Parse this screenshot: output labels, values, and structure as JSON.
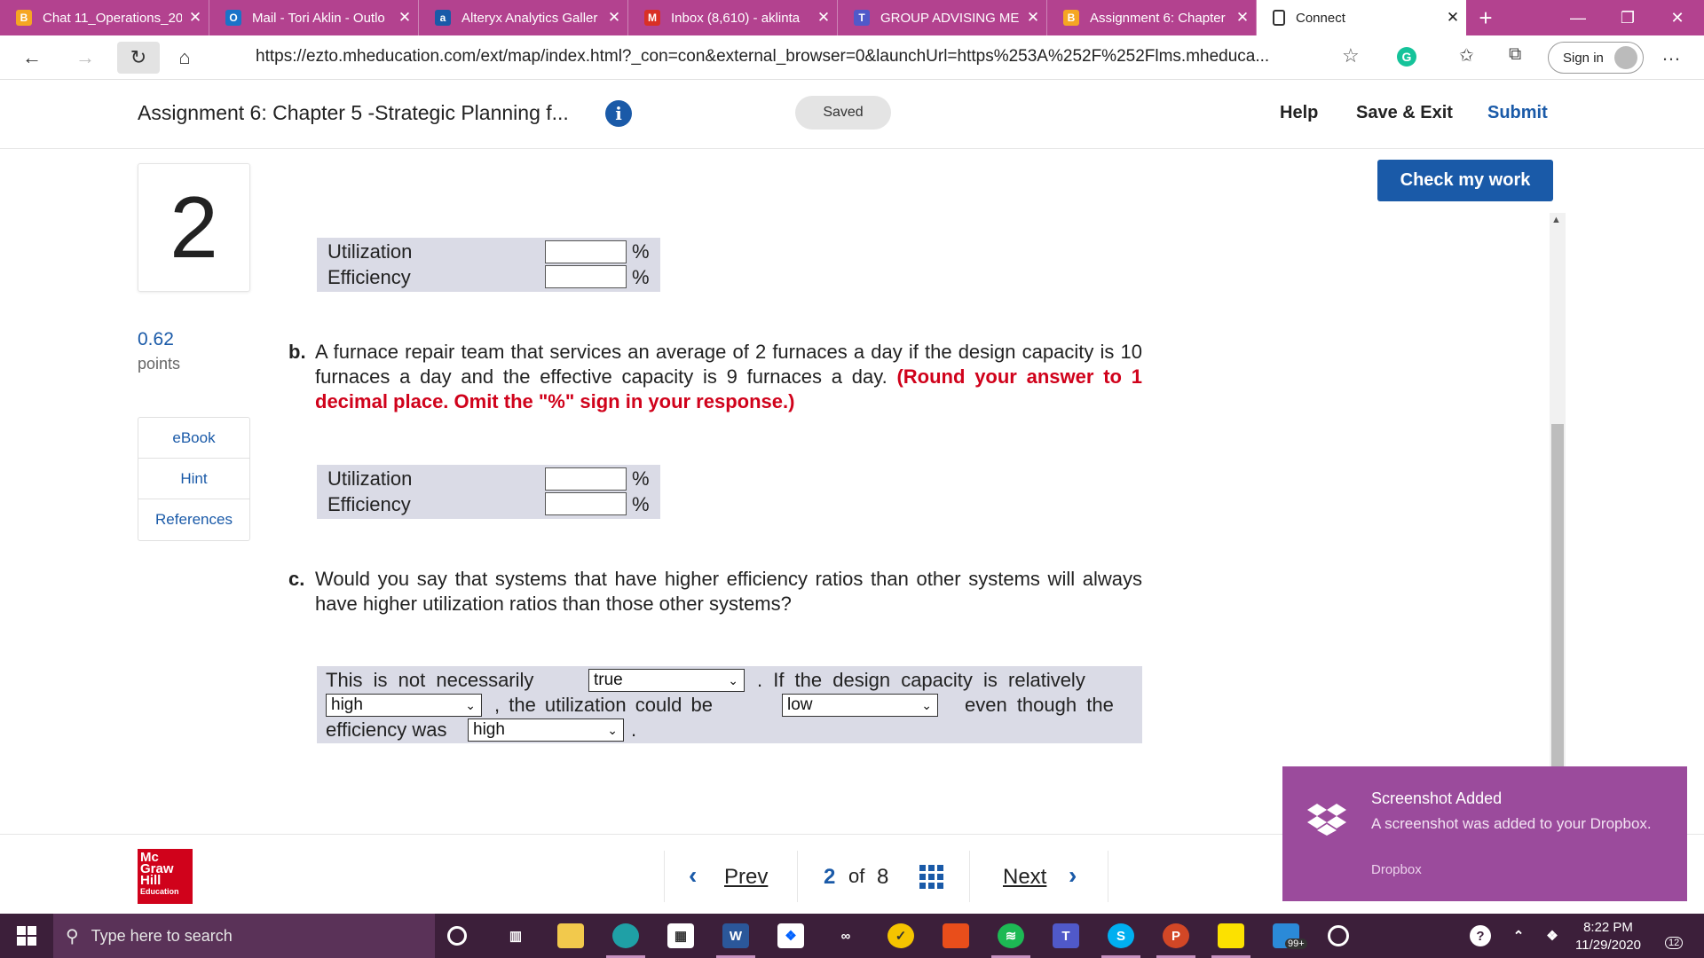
{
  "browser": {
    "tabs": [
      {
        "label": "Chat 11_Operations_20",
        "fav": "B",
        "color": "#f5a623"
      },
      {
        "label": "Mail - Tori Aklin - Outlo",
        "fav": "O",
        "color": "#1a73c8"
      },
      {
        "label": "Alteryx Analytics Galler",
        "fav": "a",
        "color": "#1a5aa8"
      },
      {
        "label": "Inbox (8,610) - aklinta",
        "fav": "M",
        "color": "#d93025"
      },
      {
        "label": "GROUP ADVISING MEE",
        "fav": "T",
        "color": "#5059c9"
      },
      {
        "label": "Assignment 6: Chapter",
        "fav": "B",
        "color": "#f5a623"
      },
      {
        "label": "Connect",
        "fav": "",
        "color": "#ffffff"
      }
    ],
    "url": "https://ezto.mheducation.com/ext/map/index.html?_con=con&external_browser=0&launchUrl=https%253A%252F%252Flms.mheduca...",
    "signin_label": "Sign in"
  },
  "header": {
    "title": "Assignment 6: Chapter 5 -Strategic Planning f...",
    "info_icon": "i",
    "saved_label": "Saved",
    "help_label": "Help",
    "save_exit_label": "Save & Exit",
    "submit_label": "Submit"
  },
  "question": {
    "number": "2",
    "points": "0.62",
    "points_label": "points",
    "side_buttons": [
      "eBook",
      "Hint",
      "References"
    ],
    "check_label": "Check my work"
  },
  "table_a": {
    "rows": [
      {
        "label": "Utilization",
        "value": "",
        "unit": "%"
      },
      {
        "label": "Efficiency",
        "value": "",
        "unit": "%"
      }
    ]
  },
  "part_b": {
    "letter": "b.",
    "text": "A furnace repair team that services an average of 2 furnaces a day if the design capacity is 10 furnaces a day and the effective capacity is 9 furnaces a day.",
    "instruction": "(Round your answer to 1 decimal place. Omit the \"%\" sign in your response.)"
  },
  "table_b": {
    "rows": [
      {
        "label": "Utilization",
        "value": "",
        "unit": "%"
      },
      {
        "label": "Efficiency",
        "value": "",
        "unit": "%"
      }
    ]
  },
  "part_c": {
    "letter": "c.",
    "text": "Would you say that systems that have higher efficiency ratios than other systems will always have higher utilization ratios than those other systems?"
  },
  "fill": {
    "t1": "This is not necessarily",
    "sel1": "true",
    "t2": ". If the design capacity is relatively",
    "sel2": "high",
    "t3": ", the utilization could be",
    "sel3": "low",
    "t4": "even though the",
    "t5": "efficiency was",
    "sel4": "high",
    "t6": "."
  },
  "footer": {
    "logo_lines": [
      "Mc",
      "Graw",
      "Hill",
      "Education"
    ],
    "prev_label": "Prev",
    "page_current": "2",
    "page_of": "of",
    "page_total": "8",
    "next_label": "Next"
  },
  "toast": {
    "title": "Screenshot Added",
    "body": "A screenshot was added to your Dropbox.",
    "source": "Dropbox",
    "accent": "#9b4b9c"
  },
  "taskbar": {
    "search_placeholder": "Type here to search",
    "time": "8:22 PM",
    "date": "11/29/2020",
    "badge_count": "99+",
    "notif_count": "12"
  }
}
